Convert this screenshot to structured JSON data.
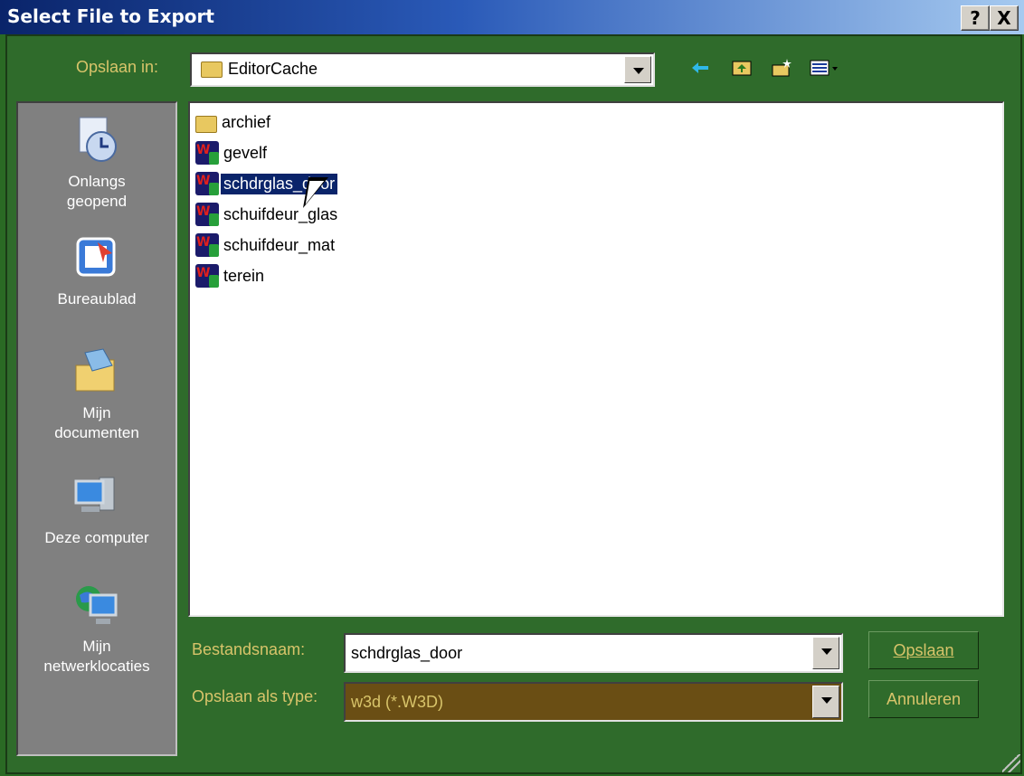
{
  "window": {
    "title": "Select File to Export",
    "help_label": "?",
    "close_label": "X"
  },
  "toolbar": {
    "save_in_label": "Opslaan in:",
    "folder": "EditorCache",
    "tool_icons": [
      "back-arrow-icon",
      "up-folder-icon",
      "new-folder-icon",
      "view-menu-icon"
    ]
  },
  "places": [
    {
      "label": "Onlangs\ngeopend",
      "icon": "recent-clock-icon"
    },
    {
      "label": "Bureaublad",
      "icon": "desktop-icon"
    },
    {
      "label": "Mijn\ndocumenten",
      "icon": "documents-folder-icon"
    },
    {
      "label": "Deze computer",
      "icon": "computer-icon"
    },
    {
      "label": "Mijn\nnetwerklocaties",
      "icon": "network-places-icon"
    }
  ],
  "files": [
    {
      "name": "archief",
      "type": "folder"
    },
    {
      "name": "gevelf",
      "type": "w3d"
    },
    {
      "name": "schdrglas_door",
      "type": "w3d",
      "selected": true
    },
    {
      "name": "schuifdeur_glas",
      "type": "w3d"
    },
    {
      "name": "schuifdeur_mat",
      "type": "w3d"
    },
    {
      "name": "terein",
      "type": "w3d"
    }
  ],
  "footer": {
    "filename_label": "Bestandsnaam:",
    "filename_value": "schdrglas_door",
    "type_label": "Opslaan als type:",
    "type_value": "w3d (*.W3D)",
    "save_button": "Opslaan",
    "cancel_button": "Annuleren"
  },
  "colors": {
    "dialog_bg": "#2f6b2b",
    "label": "#d8c46a",
    "selection": "#0a246a",
    "titlebar": "#0a246a"
  }
}
